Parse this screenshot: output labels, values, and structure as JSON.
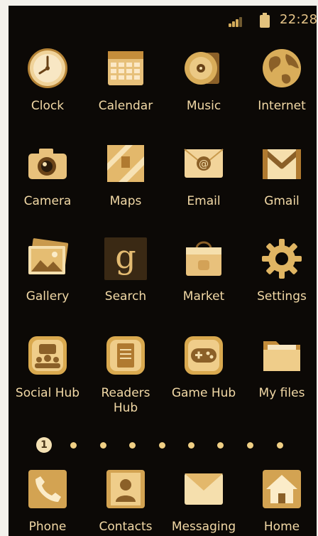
{
  "status_bar": {
    "time": "22:28",
    "signal_icon": "signal-icon",
    "battery_icon": "battery-icon"
  },
  "apps": [
    {
      "label": "Clock",
      "icon": "clock-icon"
    },
    {
      "label": "Calendar",
      "icon": "calendar-icon"
    },
    {
      "label": "Music",
      "icon": "music-icon"
    },
    {
      "label": "Internet",
      "icon": "internet-icon"
    },
    {
      "label": "Camera",
      "icon": "camera-icon"
    },
    {
      "label": "Maps",
      "icon": "maps-icon"
    },
    {
      "label": "Email",
      "icon": "email-icon"
    },
    {
      "label": "Gmail",
      "icon": "gmail-icon"
    },
    {
      "label": "Gallery",
      "icon": "gallery-icon"
    },
    {
      "label": "Search",
      "icon": "search-icon",
      "glyph": "g"
    },
    {
      "label": "Market",
      "icon": "market-icon"
    },
    {
      "label": "Settings",
      "icon": "settings-icon"
    },
    {
      "label": "Social Hub",
      "icon": "social-hub-icon"
    },
    {
      "label": "Readers Hub",
      "icon": "readers-hub-icon"
    },
    {
      "label": "Game Hub",
      "icon": "game-hub-icon"
    },
    {
      "label": "My files",
      "icon": "my-files-icon"
    }
  ],
  "page_indicator": {
    "current_page": "1",
    "total_pages": 9
  },
  "dock": [
    {
      "label": "Phone",
      "icon": "phone-icon"
    },
    {
      "label": "Contacts",
      "icon": "contacts-icon"
    },
    {
      "label": "Messaging",
      "icon": "messaging-icon"
    },
    {
      "label": "Home",
      "icon": "home-icon"
    }
  ],
  "colors": {
    "background": "#0c0906",
    "label": "#f2d9a6",
    "icon_gold": "#d9ad5a",
    "icon_light": "#f5dfad",
    "icon_dark": "#8b6028"
  }
}
